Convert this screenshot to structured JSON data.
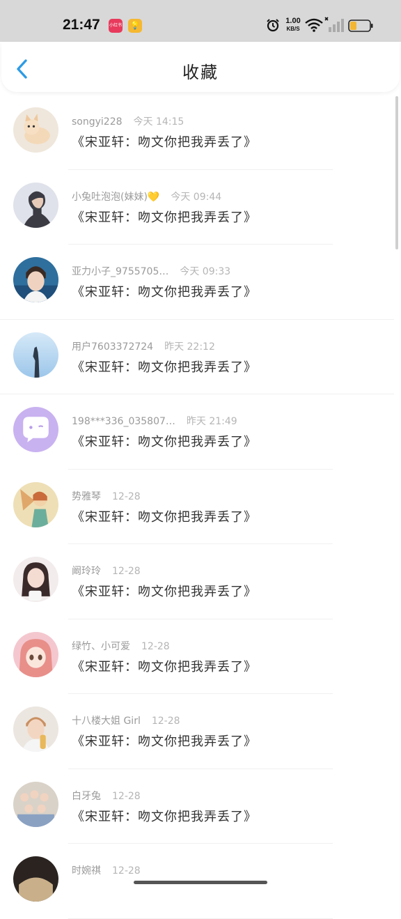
{
  "status": {
    "time": "21:47",
    "app_badge_1": "小红书",
    "net_speed_value": "1.00",
    "net_speed_unit": "KB/S",
    "battery_level": 0.35,
    "battery_color": "#f2b632"
  },
  "header": {
    "back_icon": "chevron-left-icon",
    "title": "收藏",
    "accent": "#2d9be5"
  },
  "items": [
    {
      "user": "songyi228",
      "when": "今天 14:15",
      "content": "《宋亚轩：吻文你把我弄丢了》",
      "avatar": "cat-photo"
    },
    {
      "user": "小兔吐泡泡(妹妹)💛",
      "when": "今天 09:44",
      "content": "《宋亚轩：吻文你把我弄丢了》",
      "avatar": "person-profile"
    },
    {
      "user": "亚力小子_9755705…",
      "when": "今天 09:33",
      "content": "《宋亚轩：吻文你把我弄丢了》",
      "avatar": "person-portrait"
    },
    {
      "user": "用户7603372724",
      "when": "昨天 22:12",
      "content": "《宋亚轩：吻文你把我弄丢了》",
      "avatar": "sky-silhouette"
    },
    {
      "user": "198***336_035807…",
      "when": "昨天 21:49",
      "content": "《宋亚轩：吻文你把我弄丢了》",
      "avatar": "chat-bubble-default"
    },
    {
      "user": "势雅琴",
      "when": "12-28",
      "content": "《宋亚轩：吻文你把我弄丢了》",
      "avatar": "anime-illustration"
    },
    {
      "user": "阚玲玲",
      "when": "12-28",
      "content": "《宋亚轩：吻文你把我弄丢了》",
      "avatar": "girl-photo"
    },
    {
      "user": "绿竹、小可爱",
      "when": "12-28",
      "content": "《宋亚轩：吻文你把我弄丢了》",
      "avatar": "anime-girl"
    },
    {
      "user": "十八楼大姐 Girl",
      "when": "12-28",
      "content": "《宋亚轩：吻文你把我弄丢了》",
      "avatar": "boy-photo"
    },
    {
      "user": "白牙兔",
      "when": "12-28",
      "content": "《宋亚轩：吻文你把我弄丢了》",
      "avatar": "group-photo"
    },
    {
      "user": "时婉祺",
      "when": "12-28",
      "content": "",
      "avatar": "dark-photo"
    }
  ]
}
